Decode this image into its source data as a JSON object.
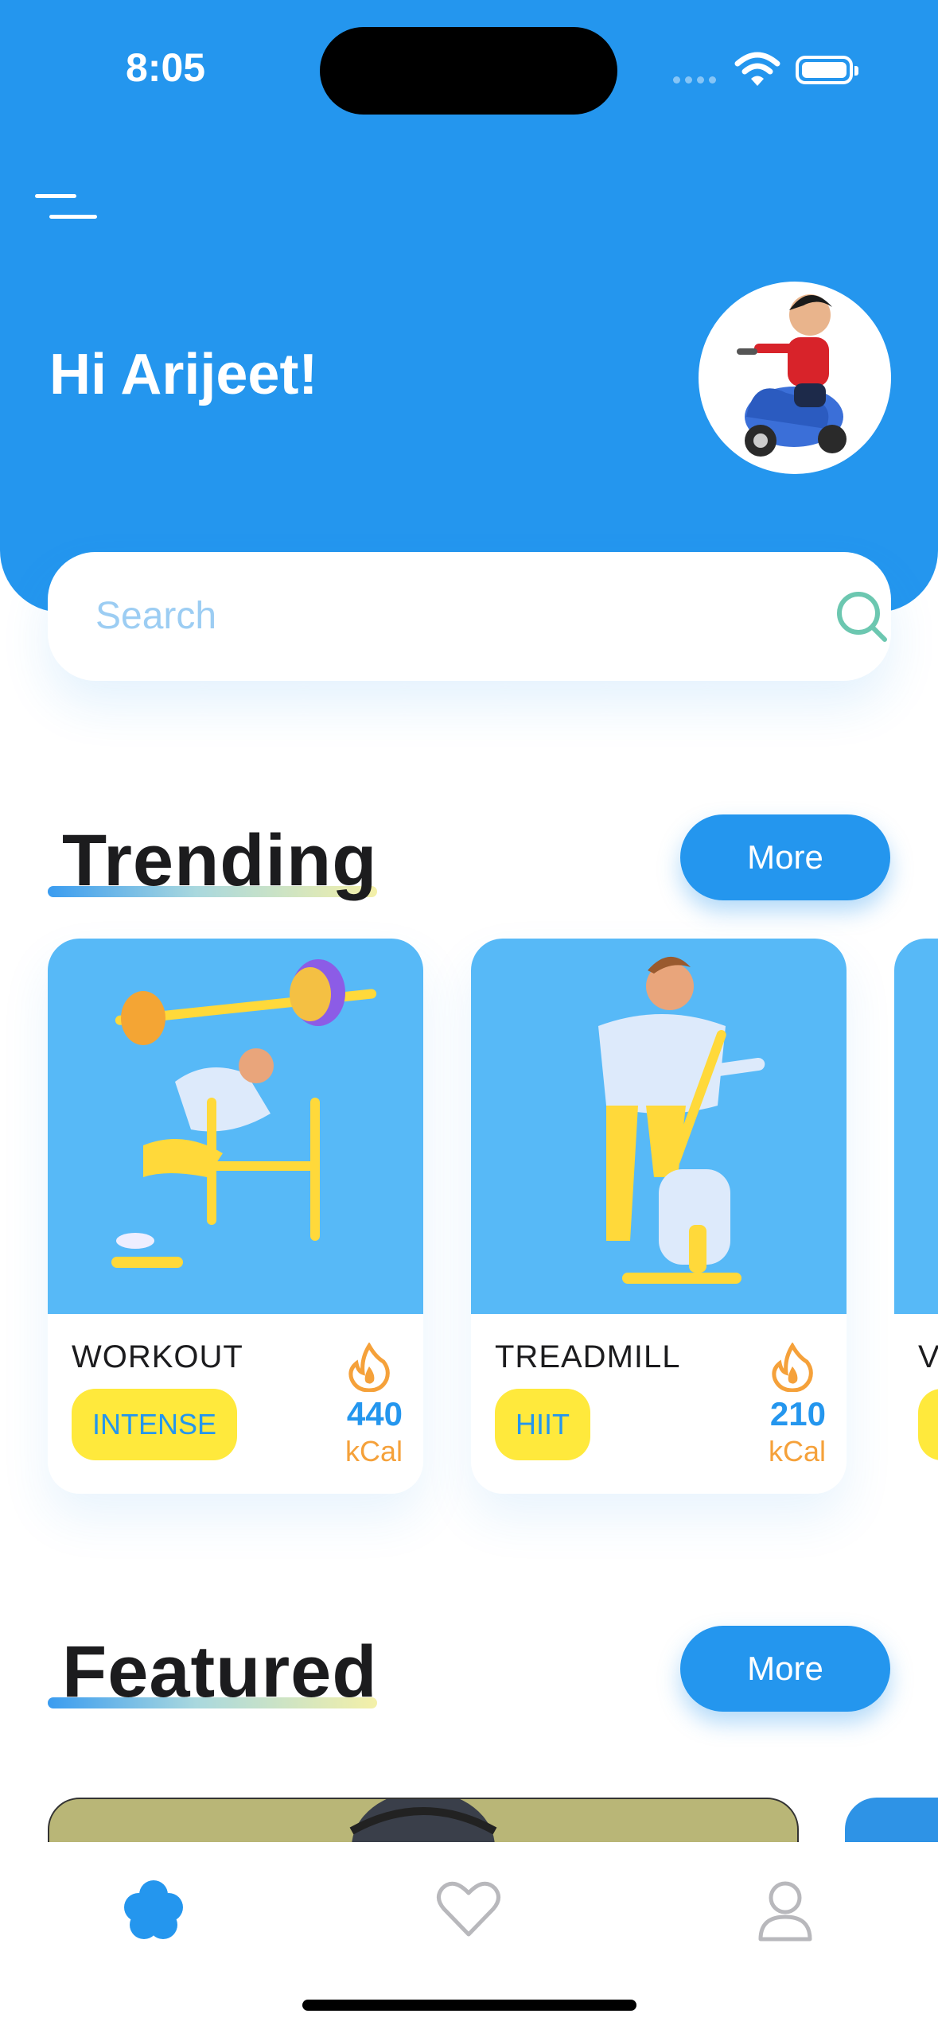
{
  "status_bar": {
    "time": "8:05"
  },
  "header": {
    "greeting": "Hi Arijeet!",
    "background_color": "#2496EE"
  },
  "search": {
    "placeholder": "Search"
  },
  "trending": {
    "title": "Trending",
    "more_label": "More",
    "cards": [
      {
        "name": "WORKOUT",
        "tag": "INTENSE",
        "kcal_value": "440",
        "kcal_unit": "kCal",
        "icon": "flame-icon"
      },
      {
        "name": "TREADMILL",
        "tag": "HIIT",
        "kcal_value": "210",
        "kcal_unit": "kCal",
        "icon": "flame-icon"
      },
      {
        "name": "V",
        "tag": "",
        "kcal_value": "",
        "kcal_unit": ""
      }
    ]
  },
  "featured": {
    "title": "Featured",
    "more_label": "More"
  },
  "tab_bar": {
    "items": [
      {
        "icon": "flower-home-icon",
        "active": true
      },
      {
        "icon": "heart-icon",
        "active": false
      },
      {
        "icon": "profile-icon",
        "active": false
      }
    ]
  },
  "colors": {
    "accent": "#2496EE",
    "tag_yellow": "#FFE93C",
    "kcal_orange": "#F5A13A",
    "card_image_bg": "#57B9F7"
  }
}
